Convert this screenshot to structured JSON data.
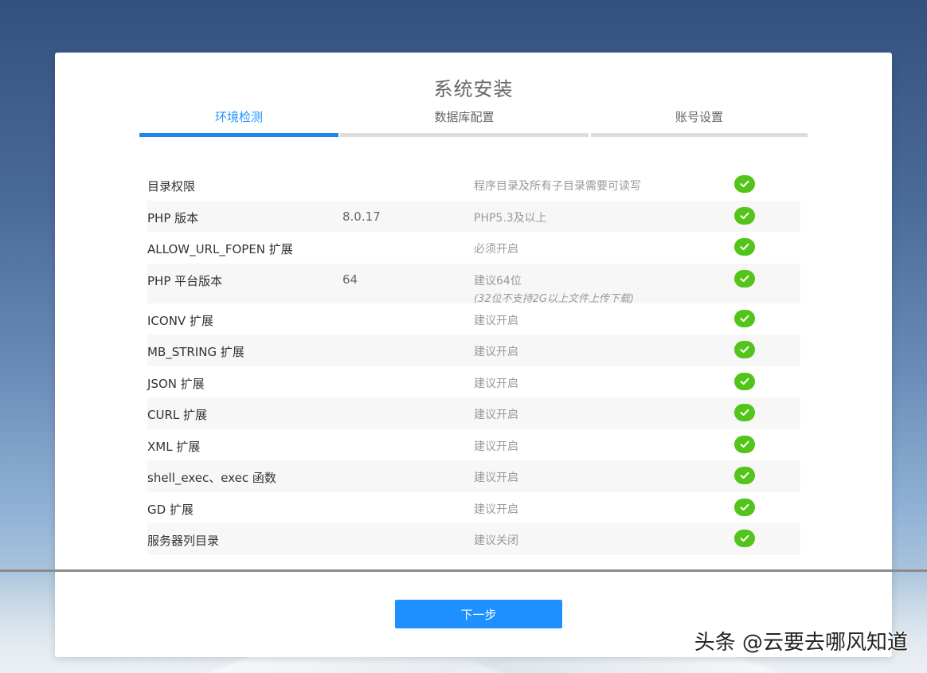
{
  "page": {
    "title": "系统安装",
    "steps": [
      "环境检测",
      "数据库配置",
      "账号设置"
    ],
    "active_step": 0,
    "next_button": "下一步",
    "watermark": "头条 @云要去哪风知道"
  },
  "checks": [
    {
      "name": "目录权限",
      "value": "",
      "requirement": "程序目录及所有子目录需要可读写",
      "note": "",
      "status": "ok"
    },
    {
      "name": "PHP 版本",
      "value": "8.0.17",
      "requirement": "PHP5.3及以上",
      "note": "",
      "status": "ok"
    },
    {
      "name": "ALLOW_URL_FOPEN 扩展",
      "value": "",
      "requirement": "必须开启",
      "note": "",
      "status": "ok"
    },
    {
      "name": "PHP 平台版本",
      "value": "64",
      "requirement": "建议64位",
      "note": "(32位不支持2G以上文件上传下载)",
      "status": "ok"
    },
    {
      "name": "ICONV 扩展",
      "value": "",
      "requirement": "建议开启",
      "note": "",
      "status": "ok"
    },
    {
      "name": "MB_STRING 扩展",
      "value": "",
      "requirement": "建议开启",
      "note": "",
      "status": "ok"
    },
    {
      "name": "JSON 扩展",
      "value": "",
      "requirement": "建议开启",
      "note": "",
      "status": "ok"
    },
    {
      "name": "CURL 扩展",
      "value": "",
      "requirement": "建议开启",
      "note": "",
      "status": "ok"
    },
    {
      "name": "XML 扩展",
      "value": "",
      "requirement": "建议开启",
      "note": "",
      "status": "ok"
    },
    {
      "name": "shell_exec、exec 函数",
      "value": "",
      "requirement": "建议开启",
      "note": "",
      "status": "ok"
    },
    {
      "name": "GD 扩展",
      "value": "",
      "requirement": "建议开启",
      "note": "",
      "status": "ok"
    },
    {
      "name": "服务器列目录",
      "value": "",
      "requirement": "建议关闭",
      "note": "",
      "status": "ok"
    }
  ],
  "colors": {
    "accent": "#1e90ff",
    "success": "#52c41a"
  }
}
